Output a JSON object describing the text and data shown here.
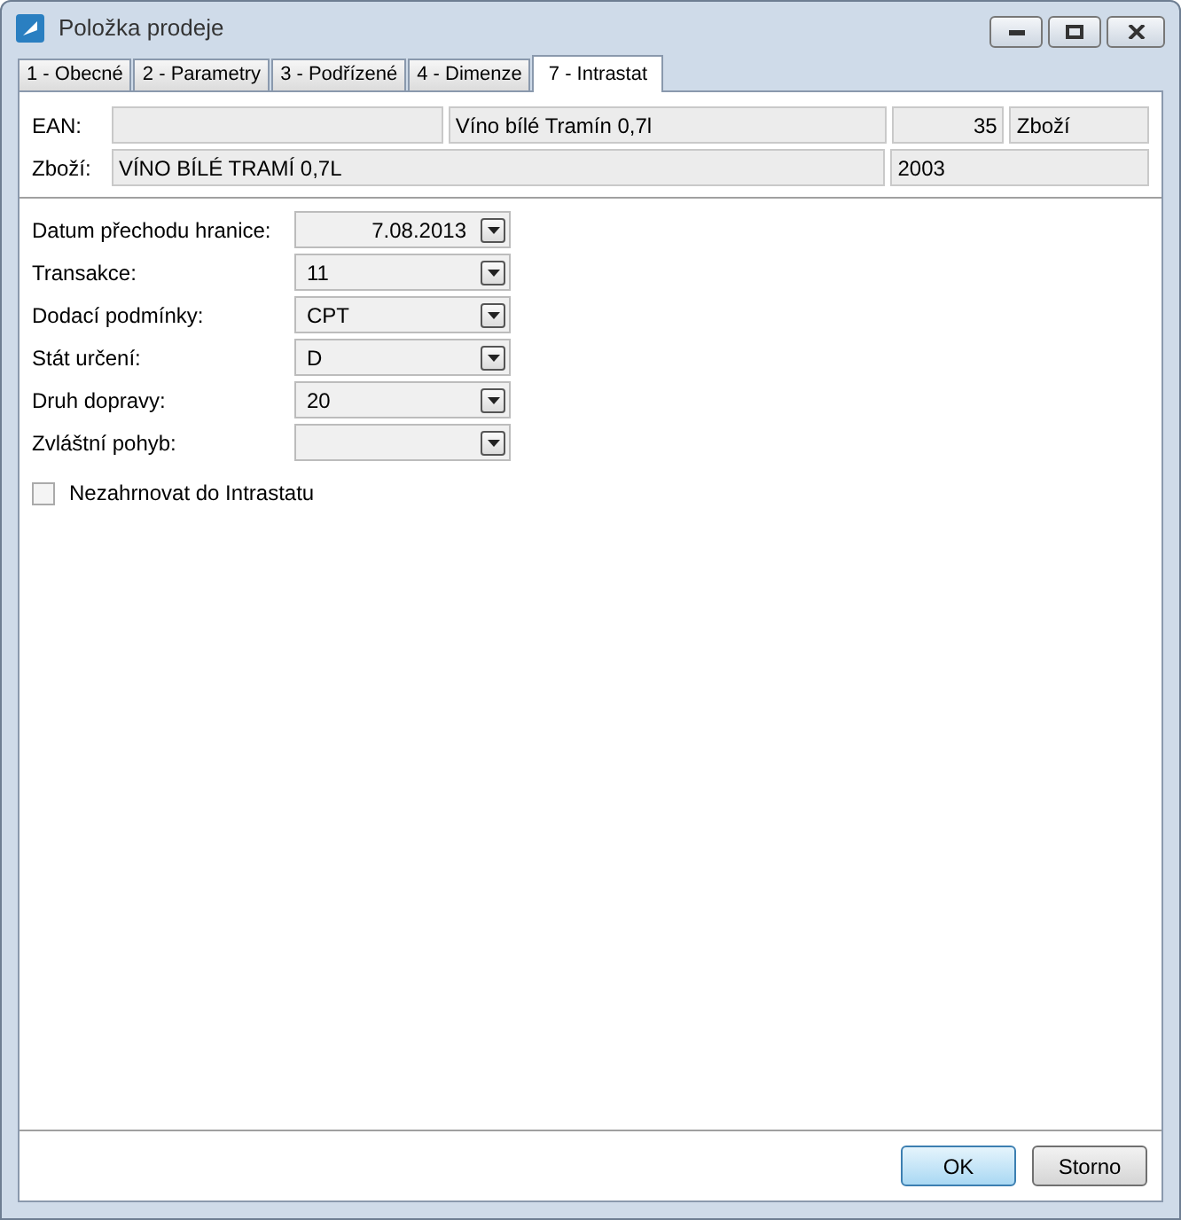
{
  "window": {
    "title": "Položka prodeje"
  },
  "tabs": [
    {
      "label": "1 - Obecné",
      "selected": false
    },
    {
      "label": "2 - Parametry",
      "selected": false
    },
    {
      "label": "3 - Podřízené",
      "selected": false
    },
    {
      "label": "4 - Dimenze",
      "selected": false
    },
    {
      "label": "7 - Intrastat",
      "selected": true
    }
  ],
  "header": [
    {
      "label": "EAN:",
      "fields": [
        {
          "kind": "text"
        },
        {
          "value": "Víno bílé Tramín 0,7l",
          "kind": "text"
        },
        {
          "value": "35",
          "kind": "number"
        },
        {
          "value": "Zboží",
          "kind": "text"
        }
      ]
    },
    {
      "label": "Zboží:",
      "fields": [
        {
          "value": "VÍNO BÍLÉ TRAMÍ 0,7L",
          "kind": "text"
        },
        {
          "value": "2003",
          "kind": "text"
        }
      ]
    }
  ],
  "form": [
    {
      "label": "Datum přechodu hranice:",
      "value": "7.08.2013",
      "kind": "date"
    },
    {
      "label": "Transakce:",
      "value": "11",
      "kind": "select"
    },
    {
      "label": "Dodací podmínky:",
      "value": "CPT",
      "kind": "select"
    },
    {
      "label": "Stát určení:",
      "value": "D",
      "kind": "select"
    },
    {
      "label": "Druh dopravy:",
      "value": "20",
      "kind": "select"
    },
    {
      "label": "Zvláštní pohyb:",
      "kind": "select"
    }
  ],
  "checkbox": {
    "label": "Nezahrnovat do Intrastatu",
    "checked": false
  },
  "buttons": [
    {
      "label": "OK",
      "default": true
    },
    {
      "label": "Storno",
      "default": false
    }
  ]
}
